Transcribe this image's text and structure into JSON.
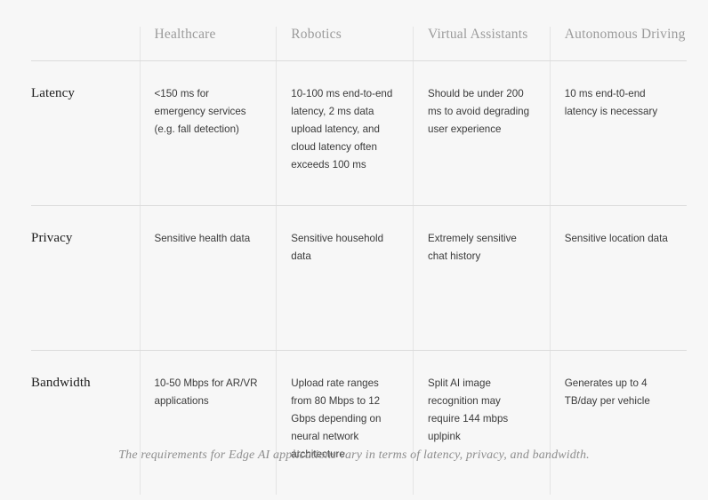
{
  "table": {
    "corner_label": "",
    "columns": [
      "Healthcare",
      "Robotics",
      "Virtual Assistants",
      "Autonomous Driving"
    ],
    "rows": [
      {
        "label": "Latency",
        "cells": [
          "<150 ms for emergency services (e.g. fall detection)",
          "10-100 ms end-to-end latency, 2 ms data upload latency, and cloud latency often exceeds 100 ms",
          "Should be under 200 ms to avoid degrading user experience",
          "10 ms end-t0-end latency is necessary"
        ]
      },
      {
        "label": "Privacy",
        "cells": [
          "Sensitive health data",
          "Sensitive household data",
          "Extremely sensitive chat history",
          "Sensitive location data"
        ]
      },
      {
        "label": "Bandwidth",
        "cells": [
          "10-50 Mbps for AR/VR applications",
          "Upload rate ranges from 80 Mbps to 12 Gbps depending on neural network architecture",
          "Split AI image recognition may require 144 mbps uplpink",
          "Generates up to 4 TB/day per vehicle"
        ]
      }
    ]
  },
  "caption": {
    "text": "The requirements for Edge AI applications vary in terms of latency, privacy, and bandwidth."
  },
  "colors": {
    "background": "#f7f7f7",
    "header_text": "#9b9b9b",
    "body_text": "#3a3a3a",
    "label_text": "#1c1c1c",
    "rule": "#dcdcdc",
    "column_divider": "#e4e4e4",
    "caption_text": "#8e8e8e"
  }
}
